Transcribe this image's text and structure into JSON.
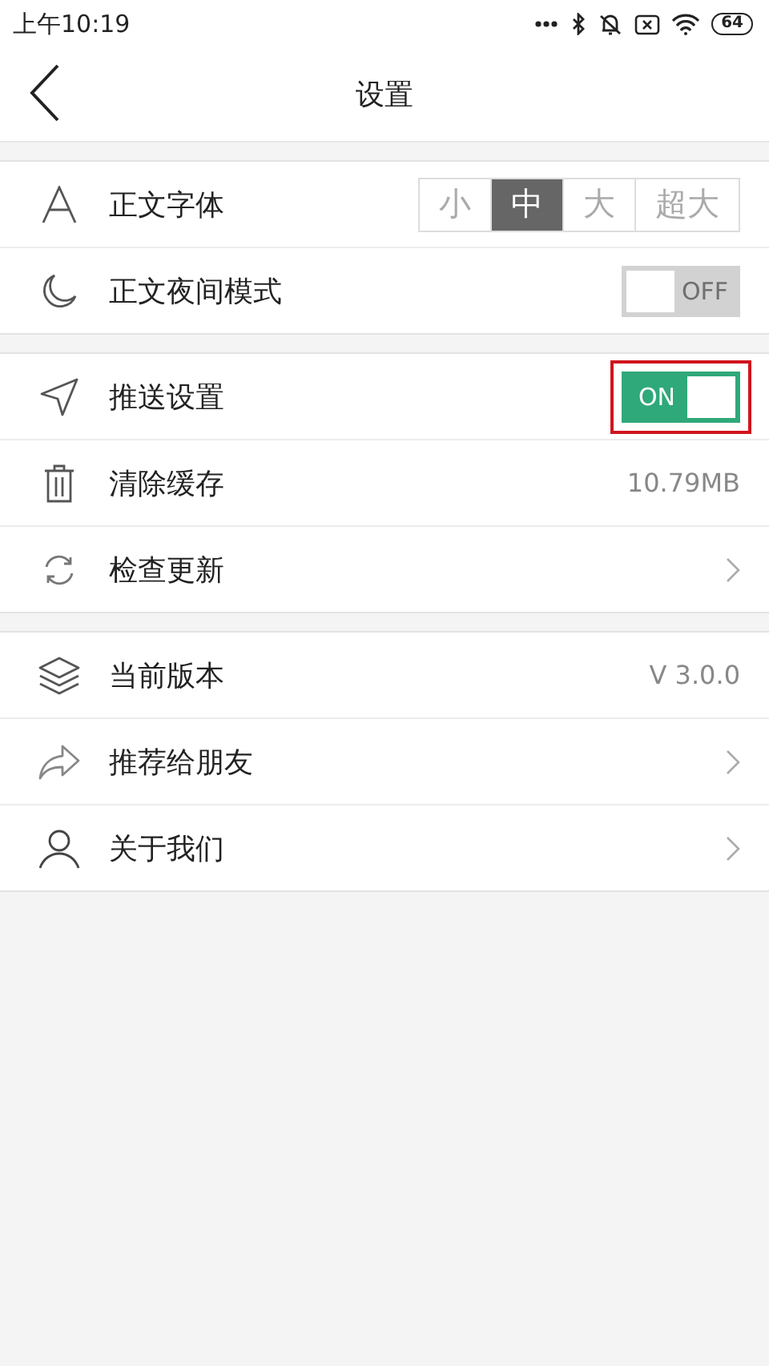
{
  "status_bar": {
    "time": "上午10:19",
    "battery": "64"
  },
  "header": {
    "title": "设置"
  },
  "groups": [
    {
      "rows": [
        {
          "kind": "segmented",
          "label": "正文字体",
          "options": [
            {
              "label": "小",
              "selected": false
            },
            {
              "label": "中",
              "selected": true
            },
            {
              "label": "大",
              "selected": false
            },
            {
              "label": "超大",
              "selected": false
            }
          ]
        },
        {
          "kind": "toggle",
          "label": "正文夜间模式",
          "on": false,
          "toggle_text": "OFF",
          "highlighted": false
        }
      ]
    },
    {
      "rows": [
        {
          "kind": "toggle",
          "label": "推送设置",
          "on": true,
          "toggle_text": "ON",
          "highlighted": true
        },
        {
          "kind": "value",
          "label": "清除缓存",
          "value": "10.79MB"
        },
        {
          "kind": "link",
          "label": "检查更新"
        }
      ]
    },
    {
      "rows": [
        {
          "kind": "value",
          "label": "当前版本",
          "value": "V 3.0.0"
        },
        {
          "kind": "link",
          "label": "推荐给朋友"
        },
        {
          "kind": "link",
          "label": "关于我们"
        }
      ]
    }
  ]
}
